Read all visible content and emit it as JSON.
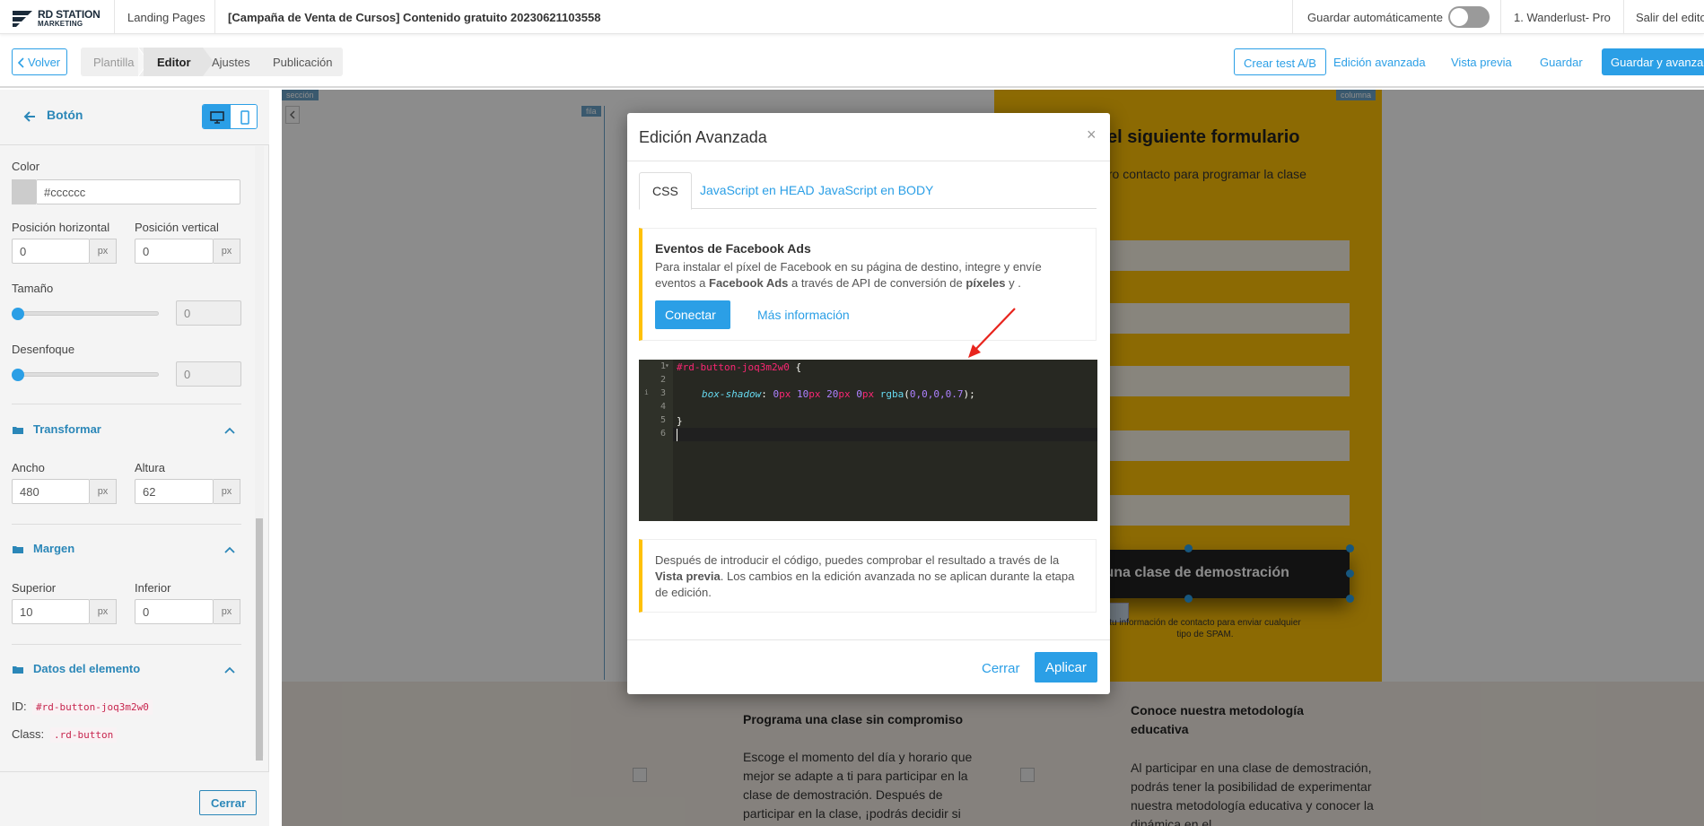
{
  "topbar": {
    "logo_line1": "RD STATION",
    "logo_line2": "MARKETING",
    "section": "Landing Pages",
    "page_title": "[Campaña de Venta de Cursos] Contenido gratuito 20230621103558",
    "autosave_label": "Guardar automáticamente",
    "autosave_on": false,
    "account": "1. Wanderlust- Pro",
    "exit": "Salir del edito"
  },
  "toolbar": {
    "back": "Volver",
    "steps": [
      "Plantilla",
      "Editor",
      "Ajustes",
      "Publicación"
    ],
    "active_step": "Editor",
    "ab_test": "Crear test A/B",
    "advanced": "Edición avanzada",
    "preview": "Vista previa",
    "save": "Guardar",
    "save_next": "Guardar y avanzar"
  },
  "sidebar": {
    "back_label": "Botón",
    "color_label": "Color",
    "color_value": "#cccccc",
    "swatch_color": "#cccccc",
    "pos_h_label": "Posición horizontal",
    "pos_h_value": "0",
    "pos_v_label": "Posición vertical",
    "pos_v_value": "0",
    "unit": "px",
    "size_label": "Tamaño",
    "size_value": "0",
    "blur_label": "Desenfoque",
    "blur_value": "0",
    "transform_title": "Transformar",
    "width_label": "Ancho",
    "width_value": "480",
    "height_label": "Altura",
    "height_value": "62",
    "margin_title": "Margen",
    "top_label": "Superior",
    "top_value": "10",
    "bottom_label": "Inferior",
    "bottom_value": "0",
    "data_title": "Datos del elemento",
    "id_label": "ID:",
    "id_value": "#rd-button-joq3m2w0",
    "class_label": "Class:",
    "class_value": ".rd-button",
    "close": "Cerrar"
  },
  "canvas": {
    "tag_section": "sección",
    "tag_row": "fila",
    "tag_column": "columna",
    "form_title": "eta el siguiente formulario",
    "form_subtitle": "r nuestro contacto para programar la clase",
    "button_text": "ro una clase de demostración",
    "spam_note": "tu información de contacto para enviar cualquier tipo de SPAM.",
    "col1_title": "Programa una clase sin compromiso",
    "col1_text": "Escoge el momento del día y horario que mejor se adapte a ti para participar en la clase de demostración. Después de participar en la clase, ¡podrás decidir si",
    "col2_title": "Conoce nuestra metodología educativa",
    "col2_text": "Al participar en una clase de demostración, podrás tener la posibilidad de experimentar nuestra metodología educativa y conocer la dinámica en el",
    "accent_yellow": "#ffc107"
  },
  "modal": {
    "title": "Edición Avanzada",
    "close_icon": "×",
    "tabs": [
      "CSS",
      "JavaScript en HEAD",
      "JavaScript en BODY"
    ],
    "active_tab": "CSS",
    "fb_title": "Eventos de Facebook Ads",
    "fb_text_1": "Para instalar el píxel de Facebook en su página de destino, integre y envíe",
    "fb_text_2a": "eventos a ",
    "fb_text_2b": "Facebook Ads",
    "fb_text_2c": " a través de API de conversión de ",
    "fb_text_2d": "píxeles",
    "fb_text_2e": " y .",
    "connect": "Conectar",
    "more_info": "Más información",
    "code_lines": [
      "1",
      "2",
      "3",
      "4",
      "5",
      "6"
    ],
    "code_selector": "#rd-button-joq3m2w0",
    "code_open": " {",
    "code_prop": "box-shadow",
    "code_colon": ": ",
    "code_v1": "0",
    "code_v2": "10",
    "code_v3": "20",
    "code_v4": "0",
    "code_unit": "px",
    "code_fn": "rgba",
    "code_args": "0,0,0,0.7",
    "code_close": "}",
    "note_1": "Después de introducir el código, puedes comprobar el resultado a través de la",
    "note_2a": "Vista previa",
    "note_2b": ". Los cambios en la edición avanzada no se aplican durante la etapa",
    "note_3": "de edición.",
    "cancel": "Cerrar",
    "apply": "Aplicar"
  }
}
